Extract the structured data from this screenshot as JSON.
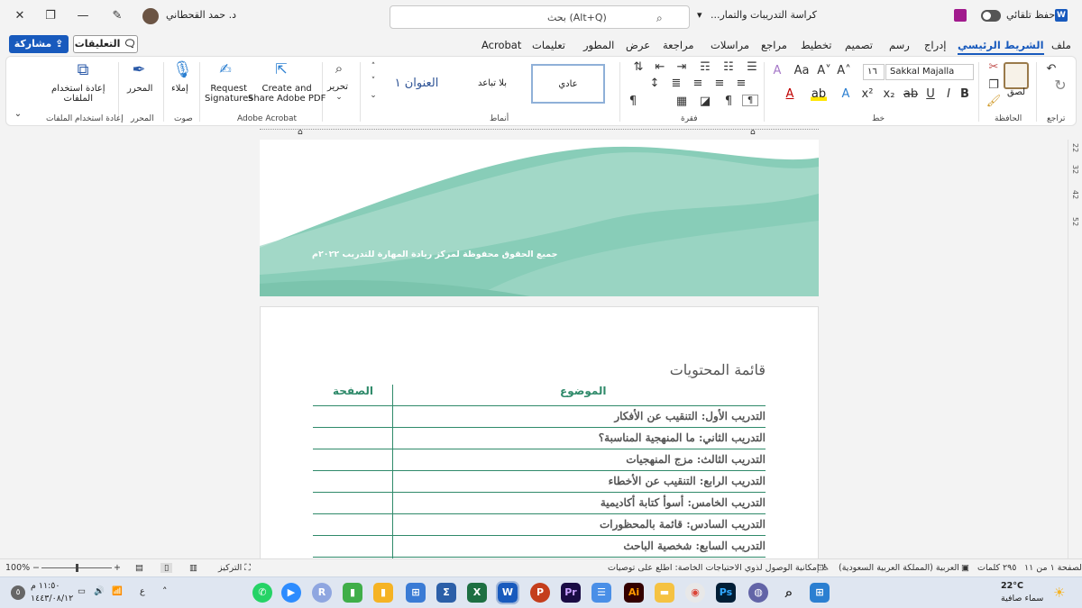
{
  "titlebar": {
    "autosave_label": "حفظ تلقائي",
    "doc_title": "كراسة التدريبات والتمار...",
    "search_placeholder": "بحث (Alt+Q)",
    "user_name": "د. حمد القحطاني"
  },
  "tabs": [
    "ملف",
    "الشريط الرئيسي",
    "إدراج",
    "رسم",
    "تصميم",
    "تخطيط",
    "مراجع",
    "مراسلات",
    "مراجعة",
    "عرض",
    "المطور",
    "تعليمات",
    "Acrobat"
  ],
  "share_label": "مشاركة",
  "comments_label": "التعليقات",
  "ribbon": {
    "groups": {
      "undo": "تراجع",
      "clipboard": "الحافظة",
      "font": "خط",
      "paragraph": "فقرة",
      "styles": "أنماط",
      "acrobat": "Adobe Acrobat",
      "voice": "صوت",
      "editor": "المحرر",
      "reuse": "إعادة استخدام الملفات"
    },
    "paste": "لصق",
    "font_name": "Sakkal Majalla",
    "font_size": "١٦",
    "styles": [
      "عادي",
      "بلا تباعد",
      "العنوان ١"
    ],
    "edit": "تحرير",
    "create_pdf": [
      "Create and",
      "Share Adobe PDF"
    ],
    "request_sig": [
      "Request",
      "Signatures"
    ],
    "dictate": "إملاء",
    "editor": "المحرر",
    "reuse": [
      "إعادة استخدام",
      "الملفات"
    ]
  },
  "page1_footer": "جميع الحقوق محفوظة لمركز ريادة المهارة للتدريب ٢٠٢٢م",
  "toc": {
    "title": "قائمة المحتويات",
    "col_topic": "الموضوع",
    "col_page": "الصفحة",
    "rows": [
      "التدريب الأول: التنقيب عن الأفكار",
      "التدريب الثاني: ما المنهجية المناسبة؟",
      "التدريب الثالث: مزج المنهجيات",
      "التدريب الرابع: التنقيب عن الأخطاء",
      "التدريب الخامس: أسوأ كتابة أكاديمية",
      "التدريب السادس: قائمة بالمحظورات",
      "التدريب السابع: شخصية الباحث"
    ]
  },
  "ruler_marks": [
    "22",
    "32",
    "42",
    "52"
  ],
  "status": {
    "page": "الصفحة ١ من ١١",
    "words": "٢٩٥ كلمات",
    "language": "العربية (المملكة العربية السعودية)",
    "accessibility": "إمكانية الوصول لذوي الاحتياجات الخاصة: اطلع على توصيات",
    "focus": "التركيز",
    "zoom": "100%"
  },
  "taskbar": {
    "weather_temp": "22°C",
    "weather_desc": "سماء صافية",
    "time": "١١:٥٠ م",
    "date": "١٤٤٣/٠٨/١٢",
    "lang": "ع",
    "notif_count": "٥"
  }
}
